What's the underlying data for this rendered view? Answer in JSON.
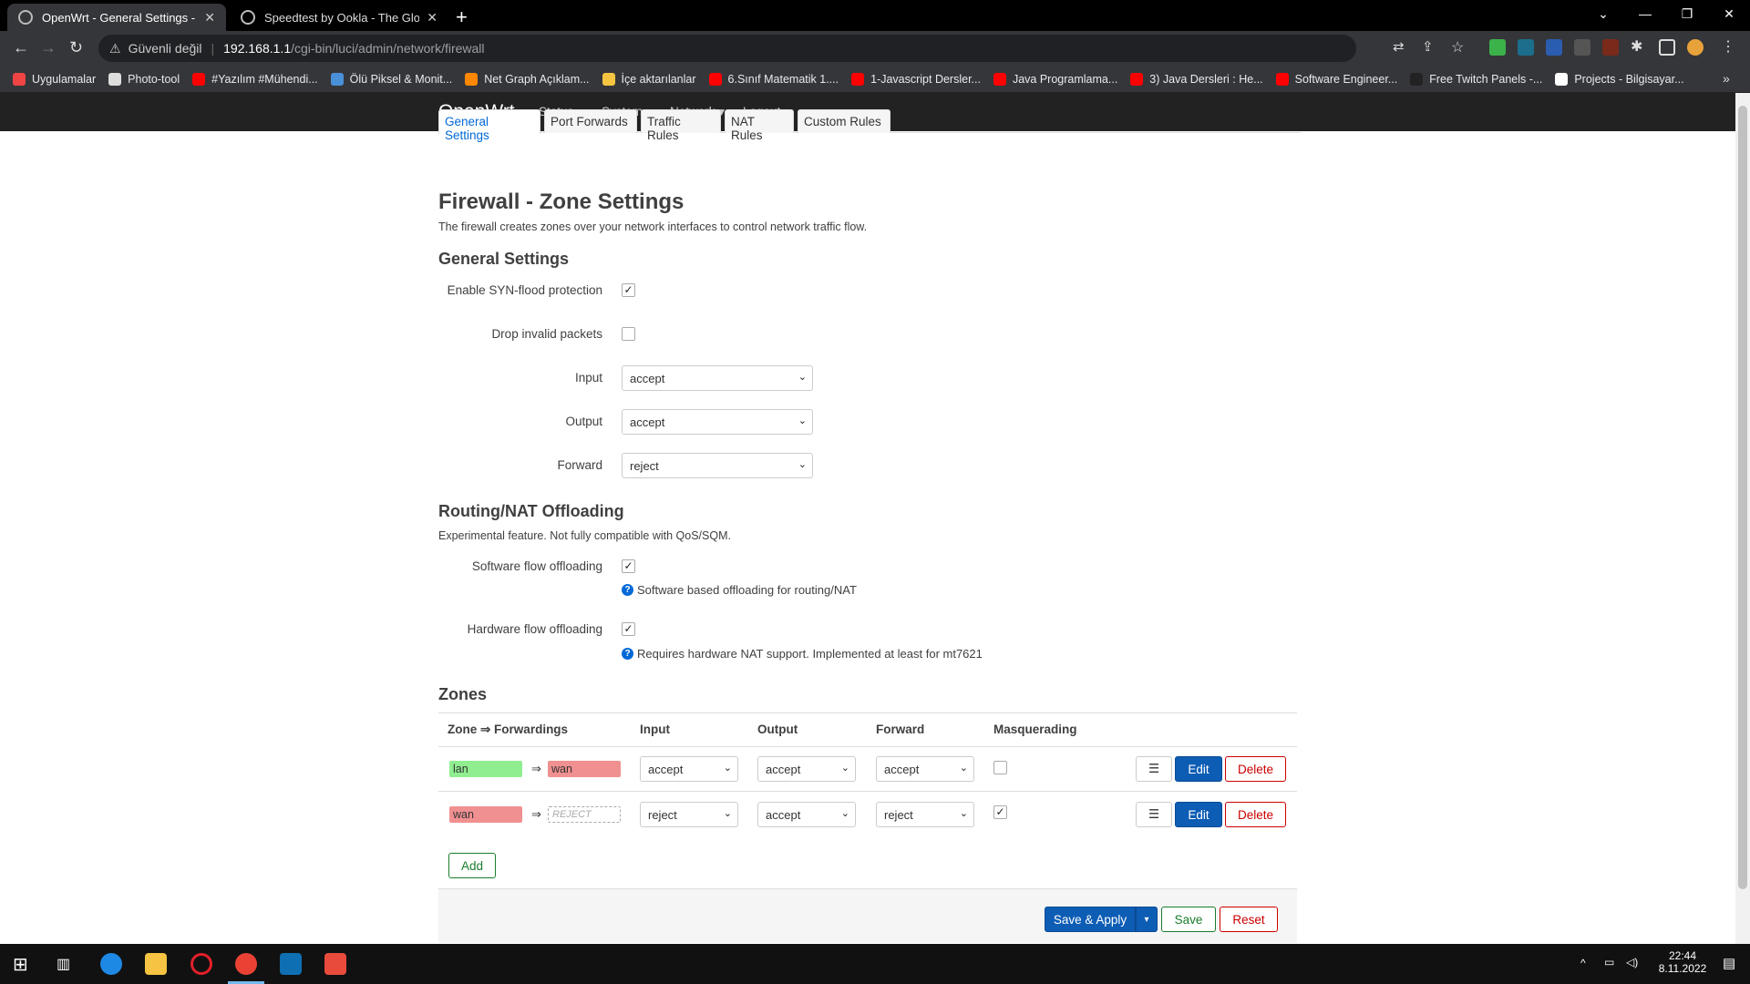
{
  "browser": {
    "tabs": [
      {
        "title": "OpenWrt - General Settings - Lu",
        "close": "✕"
      },
      {
        "title": "Speedtest by Ookla - The Global",
        "close": "✕"
      }
    ],
    "new_tab": "+",
    "security_label": "Güvenli değil",
    "url_host": "192.168.1.1",
    "url_path": "/cgi-bin/luci/admin/network/firewall",
    "bookmarks": [
      {
        "label": "Uygulamalar",
        "color": "#e44"
      },
      {
        "label": "Photo-tool",
        "color": "#ddd"
      },
      {
        "label": "#Yazılım #Mühendi...",
        "color": "#f00"
      },
      {
        "label": "Ölü Piksel & Monit...",
        "color": "#4a90d9"
      },
      {
        "label": "Net Graph Açıklam...",
        "color": "#f80"
      },
      {
        "label": "İçe aktarılanlar",
        "color": "#f5c542"
      },
      {
        "label": "6.Sınıf Matematik 1....",
        "color": "#f00"
      },
      {
        "label": "1-Javascript Dersler...",
        "color": "#f00"
      },
      {
        "label": "Java Programlama...",
        "color": "#f00"
      },
      {
        "label": "3) Java Dersleri : He...",
        "color": "#f00"
      },
      {
        "label": "Software Engineer...",
        "color": "#f00"
      },
      {
        "label": "Free Twitch Panels -...",
        "color": "#222"
      },
      {
        "label": "Projects - Bilgisayar...",
        "color": "#fff"
      }
    ],
    "bookmarks_more": "»"
  },
  "header": {
    "brand": "OpenWrt",
    "menu": [
      {
        "label": "Status ▾"
      },
      {
        "label": "System ▾"
      },
      {
        "label": "Network ▾"
      },
      {
        "label": "Logout"
      }
    ]
  },
  "tabs": [
    {
      "label": "General Settings"
    },
    {
      "label": "Port Forwards"
    },
    {
      "label": "Traffic Rules"
    },
    {
      "label": "NAT Rules"
    },
    {
      "label": "Custom Rules"
    }
  ],
  "page": {
    "title": "Firewall - Zone Settings",
    "description": "The firewall creates zones over your network interfaces to control network traffic flow."
  },
  "general": {
    "heading": "General Settings",
    "syn_label": "Enable SYN-flood protection",
    "syn_checked": "✓",
    "drop_label": "Drop invalid packets",
    "drop_checked": "",
    "input_label": "Input",
    "input_value": "accept",
    "output_label": "Output",
    "output_value": "accept",
    "forward_label": "Forward",
    "forward_value": "reject"
  },
  "offloading": {
    "heading": "Routing/NAT Offloading",
    "description": "Experimental feature. Not fully compatible with QoS/SQM.",
    "sw_label": "Software flow offloading",
    "sw_checked": "✓",
    "sw_help": "Software based offloading for routing/NAT",
    "hw_label": "Hardware flow offloading",
    "hw_checked": "✓",
    "hw_help": "Requires hardware NAT support. Implemented at least for mt7621"
  },
  "zones": {
    "heading": "Zones",
    "columns": [
      "Zone ⇒ Forwardings",
      "Input",
      "Output",
      "Forward",
      "Masquerading"
    ],
    "rows": [
      {
        "zone": "lan",
        "zone_color": "#90ee90",
        "arrow": "⇒",
        "forward_to": "wan",
        "forward_color": "#f09090",
        "input": "accept",
        "output": "accept",
        "forward": "accept",
        "masq": ""
      },
      {
        "zone": "wan",
        "zone_color": "#f09090",
        "arrow": "⇒",
        "forward_to": "REJECT",
        "forward_color": "",
        "input": "reject",
        "output": "accept",
        "forward": "reject",
        "masq": "✓"
      }
    ],
    "menu_label": "☰",
    "edit_label": "Edit",
    "delete_label": "Delete",
    "add_label": "Add"
  },
  "actions": {
    "apply_label": "Save & Apply",
    "apply_drop": "▾",
    "save_label": "Save",
    "reset_label": "Reset"
  },
  "taskbar": {
    "time": "22:44",
    "date": "8.11.2022"
  }
}
